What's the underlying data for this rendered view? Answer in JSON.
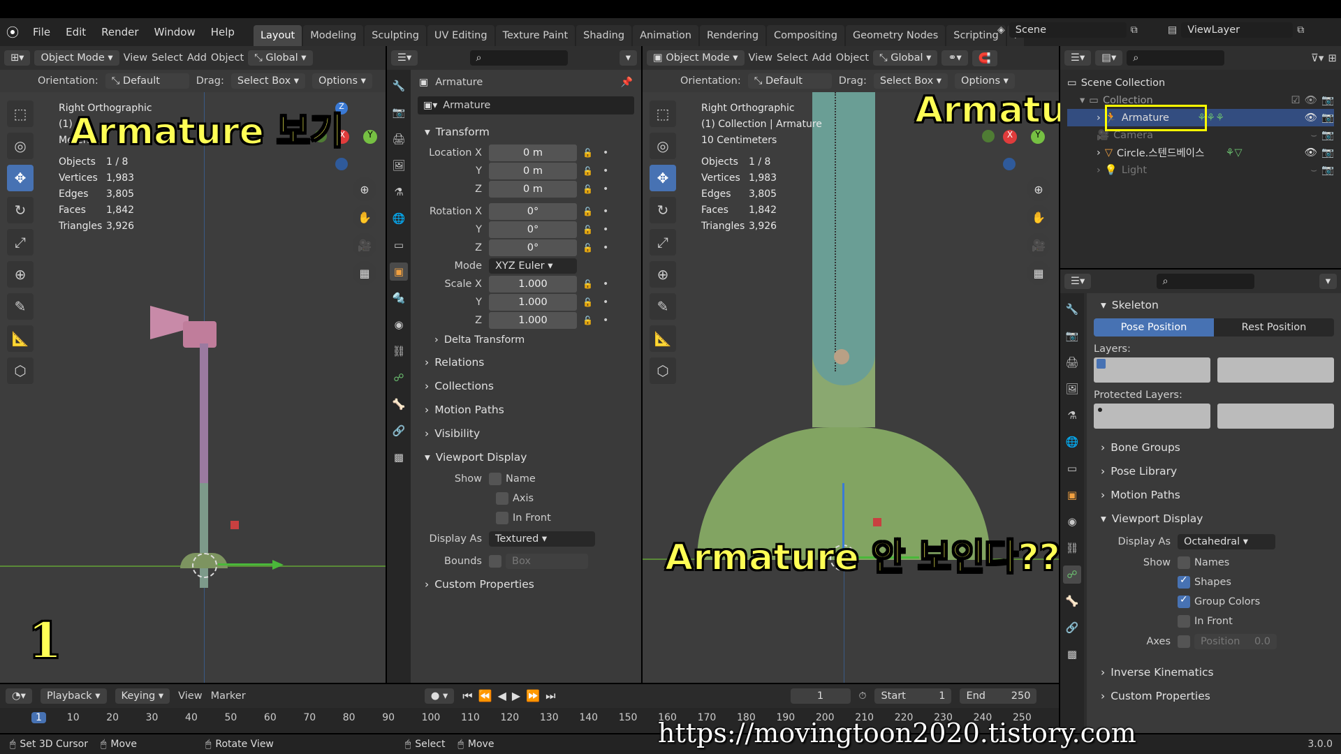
{
  "app": {
    "version": "3.0.0"
  },
  "menu": [
    "File",
    "Edit",
    "Render",
    "Window",
    "Help"
  ],
  "workspaces": [
    "Layout",
    "Modeling",
    "Sculpting",
    "UV Editing",
    "Texture Paint",
    "Shading",
    "Animation",
    "Rendering",
    "Compositing",
    "Geometry Nodes",
    "Scripting"
  ],
  "active_workspace": "Layout",
  "scene_name": "Scene",
  "view_layer": "ViewLayer",
  "left_view": {
    "mode": "Object Mode",
    "menus": [
      "View",
      "Select",
      "Add",
      "Object"
    ],
    "transform": "Global",
    "orientation_label": "Orientation:",
    "orientation": "Default",
    "drag_label": "Drag:",
    "drag": "Select Box",
    "options": "Options",
    "title": "Right Orthographic",
    "line2": "(1)",
    "line3": "Meters",
    "stats": [
      [
        "Objects",
        "1 / 8"
      ],
      [
        "Vertices",
        "1,983"
      ],
      [
        "Edges",
        "3,805"
      ],
      [
        "Faces",
        "1,842"
      ],
      [
        "Triangles",
        "3,926"
      ]
    ]
  },
  "right_view": {
    "mode": "Object Mode",
    "menus": [
      "View",
      "Select",
      "Add",
      "Object"
    ],
    "transform": "Global",
    "orientation_label": "Orientation:",
    "orientation": "Default",
    "drag_label": "Drag:",
    "drag": "Select Box",
    "options": "Options",
    "title": "Right Orthographic",
    "line2": "(1) Collection | Armature",
    "line3": "10 Centimeters",
    "stats": [
      [
        "Objects",
        "1 / 8"
      ],
      [
        "Vertices",
        "1,983"
      ],
      [
        "Edges",
        "3,805"
      ],
      [
        "Faces",
        "1,842"
      ],
      [
        "Triangles",
        "3,926"
      ]
    ]
  },
  "overlays": {
    "left_title": "Armature 보기",
    "right_title": "Armature",
    "bottom_caption": "Armature 안 보인다???",
    "number": "1",
    "url": "https://movingtoon2020.tistory.com"
  },
  "object_props": {
    "breadcrumb": "Armature",
    "name": "Armature",
    "transform": "Transform",
    "location": {
      "label": "Location X",
      "x": "0 m",
      "y": "0 m",
      "z": "0 m"
    },
    "rotation": {
      "label": "Rotation X",
      "x": "0°",
      "y": "0°",
      "z": "0°"
    },
    "mode_label": "Mode",
    "mode": "XYZ Euler",
    "scale": {
      "label": "Scale X",
      "x": "1.000",
      "y": "1.000",
      "z": "1.000"
    },
    "y_label": "Y",
    "z_label": "Z",
    "delta": "Delta Transform",
    "sections": [
      "Relations",
      "Collections",
      "Motion Paths",
      "Visibility"
    ],
    "viewport_display": "Viewport Display",
    "show_label": "Show",
    "show_items": [
      "Name",
      "Axis",
      "In Front"
    ],
    "display_as_label": "Display As",
    "display_as": "Textured",
    "bounds_label": "Bounds",
    "bounds": "Box",
    "custom": "Custom Properties"
  },
  "outliner": {
    "root": "Scene Collection",
    "collection": "Collection",
    "items": [
      "Armature",
      "Camera",
      "Circle.스텐드베이스",
      "Light"
    ]
  },
  "armature_props": {
    "skeleton": "Skeleton",
    "pose_position": "Pose Position",
    "rest_position": "Rest Position",
    "layers": "Layers:",
    "protected_layers": "Protected Layers:",
    "sections": [
      "Bone Groups",
      "Pose Library",
      "Motion Paths"
    ],
    "viewport_display": "Viewport Display",
    "display_as_label": "Display As",
    "display_as": "Octahedral",
    "show_label": "Show",
    "show_items": [
      {
        "label": "Names",
        "checked": false
      },
      {
        "label": "Shapes",
        "checked": true
      },
      {
        "label": "Group Colors",
        "checked": true
      },
      {
        "label": "In Front",
        "checked": false
      }
    ],
    "axes_label": "Axes",
    "axes_position": "Position",
    "axes_value": "0.0",
    "inverse_kinematics": "Inverse Kinematics",
    "custom": "Custom Properties"
  },
  "timeline": {
    "menus": [
      "Playback",
      "Keying",
      "View",
      "Marker"
    ],
    "current_frame": "1",
    "start_label": "Start",
    "start": "1",
    "end_label": "End",
    "end": "250",
    "ticks": [
      "1",
      "10",
      "20",
      "30",
      "40",
      "50",
      "60",
      "70",
      "80",
      "90",
      "100",
      "110",
      "120",
      "130",
      "140",
      "150",
      "160",
      "170",
      "180",
      "190",
      "200",
      "210",
      "220",
      "230",
      "240",
      "250"
    ]
  },
  "status": {
    "items": [
      "Set 3D Cursor",
      "Move",
      "Rotate View",
      "Select",
      "Move"
    ]
  },
  "colors": {
    "accent": "#4772b3",
    "overlay_text": "#ffff55",
    "highlight_box": "#ffff00"
  }
}
